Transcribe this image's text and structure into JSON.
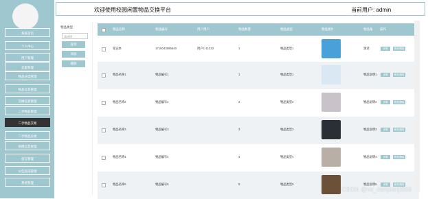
{
  "header": {
    "title": "欢迎使用校园闲置物品交换平台",
    "user_label": "当前用户: admin"
  },
  "sidebar": {
    "items": [
      {
        "label": "系统首页"
      },
      {
        "label": "个人中心"
      },
      {
        "label": "用户管理"
      },
      {
        "label": "卖家管理"
      },
      {
        "label": "物品分类管理"
      },
      {
        "label": "物品信息管理"
      },
      {
        "label": "交换信息管理"
      },
      {
        "label": "二手物品管理"
      },
      {
        "label": "二手物品交易"
      },
      {
        "label": "二手物品分类"
      },
      {
        "label": "捐赠信息管理"
      },
      {
        "label": "留言管理"
      },
      {
        "label": "公告资讯管理"
      },
      {
        "label": "系统管理"
      }
    ]
  },
  "filter": {
    "title": "物品类型",
    "select_placeholder": "请选择",
    "buttons": [
      "查询",
      "添加",
      "删除"
    ]
  },
  "table": {
    "headers": [
      "物品名称",
      "物品编号",
      "用户用户",
      "物品数量",
      "物品类型",
      "物品图片",
      "物品备",
      "操作"
    ],
    "actions": {
      "detail": "详情",
      "edit": "修改/删除"
    },
    "rows": [
      {
        "name": "笔记本",
        "code": "1716043086540",
        "user": "用户1-11233",
        "qty": "1",
        "type": "物品类型1",
        "remark": "测试",
        "thumb_color": "#4aa0d8"
      },
      {
        "name": "物品名称1",
        "code": "物品编号1",
        "user": "",
        "qty": "1",
        "type": "物品类型1",
        "remark": "物品说明1",
        "thumb_color": "#d9e8f2"
      },
      {
        "name": "物品名称2",
        "code": "物品编号2",
        "user": "",
        "qty": "2",
        "type": "物品类型2",
        "remark": "物品说明2",
        "thumb_color": "#c9c2c8"
      },
      {
        "name": "物品名称3",
        "code": "物品编号3",
        "user": "",
        "qty": "3",
        "type": "物品类型3",
        "remark": "物品说明3",
        "thumb_color": "#2a2f36"
      },
      {
        "name": "物品名称4",
        "code": "物品编号4",
        "user": "",
        "qty": "4",
        "type": "物品类型4",
        "remark": "物品说明4",
        "thumb_color": "#b8b0a6"
      },
      {
        "name": "物品名称5",
        "code": "物品编号5",
        "user": "",
        "qty": "5",
        "type": "物品类型5",
        "remark": "物品说明5",
        "thumb_color": "#6b5138"
      }
    ]
  },
  "watermark": "CSDN @vx_danpianji889",
  "colors": {
    "accent": "#9fc7cf"
  }
}
